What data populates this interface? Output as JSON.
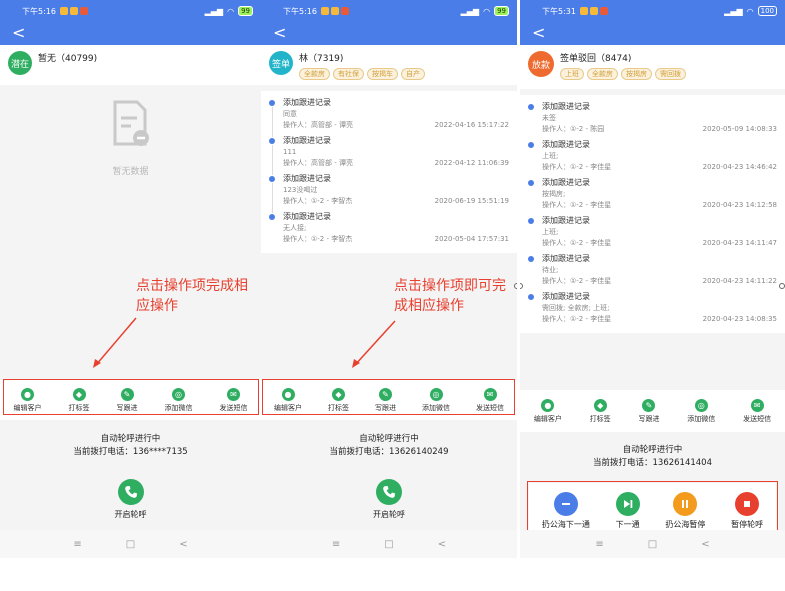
{
  "screens": [
    {
      "status_time": "下午5:16",
      "battery": "99",
      "back": "<",
      "avatar_label": "潜在",
      "avatar_color": "#2fae62",
      "name": "暂无（40799)",
      "empty_text": "暂无数据",
      "annotation": "点击操作项完成相应操作",
      "call_status": "自动轮呼进行中",
      "call_number": "当前拨打电话：136****7135",
      "start_label": "开启轮呼"
    },
    {
      "status_time": "下午5:16",
      "battery": "99",
      "back": "<",
      "avatar_label": "签单",
      "avatar_color": "#22b5c9",
      "name": "林（7319)",
      "tags": [
        "全款房",
        "有社保",
        "按揭车",
        "自产"
      ],
      "records": [
        {
          "title": "添加跟进记录",
          "content": "同意",
          "operator": "操作人：高管部 - 谭亮",
          "time": "2022-04-16 15:17:22"
        },
        {
          "title": "添加跟进记录",
          "content": "111",
          "operator": "操作人：高管部 - 谭亮",
          "time": "2022-04-12 11:06:39"
        },
        {
          "title": "添加跟进记录",
          "content": "123没喝过",
          "operator": "操作人：①-2 - 李智杰",
          "time": "2020-06-19 15:51:19"
        },
        {
          "title": "添加跟进记录",
          "content": "无人接;",
          "operator": "操作人：①-2 - 李智杰",
          "time": "2020-05-04 17:57:31"
        }
      ],
      "annotation": "点击操作项即可完成相应操作",
      "call_status": "自动轮呼进行中",
      "call_number": "当前拨打电话：13626140249",
      "start_label": "开启轮呼"
    },
    {
      "status_time": "下午5:31",
      "battery": "100",
      "back": "<",
      "avatar_label": "放款",
      "avatar_color": "#ef6a2f",
      "name": "签单驳回（8474)",
      "tags": [
        "上班",
        "全款房",
        "按揭房",
        "需回拨"
      ],
      "records": [
        {
          "title": "添加跟进记录",
          "content": "未签",
          "operator": "操作人：①-2 - 陈园",
          "time": "2020-05-09 14:08:33"
        },
        {
          "title": "添加跟进记录",
          "content": "上班;",
          "operator": "操作人：①-2 - 李佳星",
          "time": "2020-04-23 14:46:42"
        },
        {
          "title": "添加跟进记录",
          "content": "按揭房;",
          "operator": "操作人：①-2 - 李佳星",
          "time": "2020-04-23 14:12:58"
        },
        {
          "title": "添加跟进记录",
          "content": "上班;",
          "operator": "操作人：①-2 - 李佳星",
          "time": "2020-04-23 14:11:47"
        },
        {
          "title": "添加跟进记录",
          "content": "待业;",
          "operator": "操作人：①-2 - 李佳星",
          "time": "2020-04-23 14:11:22"
        },
        {
          "title": "添加跟进记录",
          "content": "需回拨; 全款房; 上班;",
          "operator": "操作人：①-2 - 李佳星",
          "time": "2020-04-23 14:08:35"
        }
      ],
      "call_status": "自动轮呼进行中",
      "call_number": "当前拨打电话：13626141404",
      "controls": [
        "扔公海下一通",
        "下一通",
        "扔公海暂停",
        "暂停轮呼"
      ]
    }
  ],
  "actions": [
    "编辑客户",
    "打标签",
    "写跟进",
    "添加微信",
    "发送短信"
  ],
  "sysnav": [
    "≡",
    "□",
    "<"
  ],
  "colors": {
    "primary": "#4b7de8",
    "green": "#2fae62",
    "annotation": "#e8402f",
    "orange": "#f29b1d",
    "red": "#e8402f"
  }
}
